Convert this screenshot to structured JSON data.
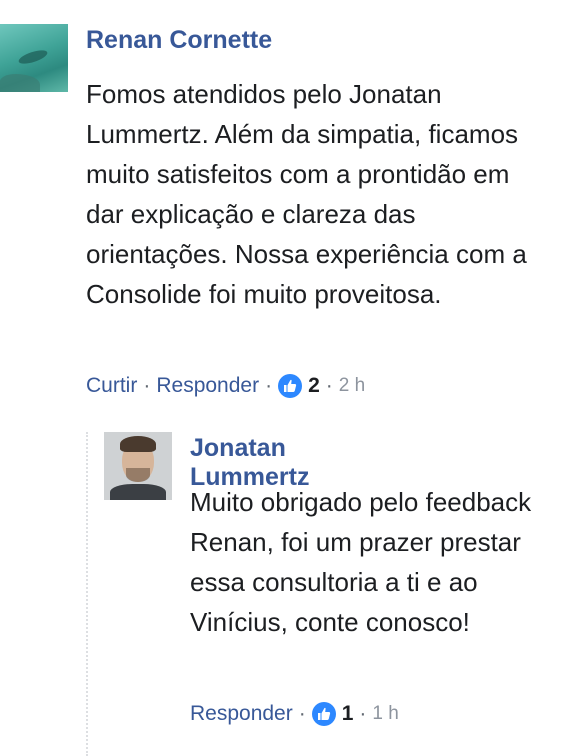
{
  "comment": {
    "author": "Renan Cornette",
    "text": "Fomos atendidos pelo Jonatan Lummertz. Além da simpatia, ficamos muito satisfeitos com a prontidão em dar explicação e clareza das orientações. Nossa experiência com a Consolide foi muito proveitosa.",
    "actions": {
      "like_label": "Curtir",
      "reply_label": "Responder",
      "reaction_icon": "thumbs-up-icon",
      "reaction_count": "2",
      "time": "2 h"
    }
  },
  "reply": {
    "author": "Jonatan Lummertz",
    "text": "Muito obrigado pelo feedback Renan, foi um prazer prestar essa consultoria a ti e ao Vinícius, conte conosco!",
    "actions": {
      "reply_label": "Responder",
      "reaction_icon": "thumbs-up-icon",
      "reaction_count": "1",
      "time": "1 h"
    }
  },
  "colors": {
    "author_link": "#385898",
    "like_badge": "#2d88ff",
    "timestamp": "#8d949e"
  }
}
